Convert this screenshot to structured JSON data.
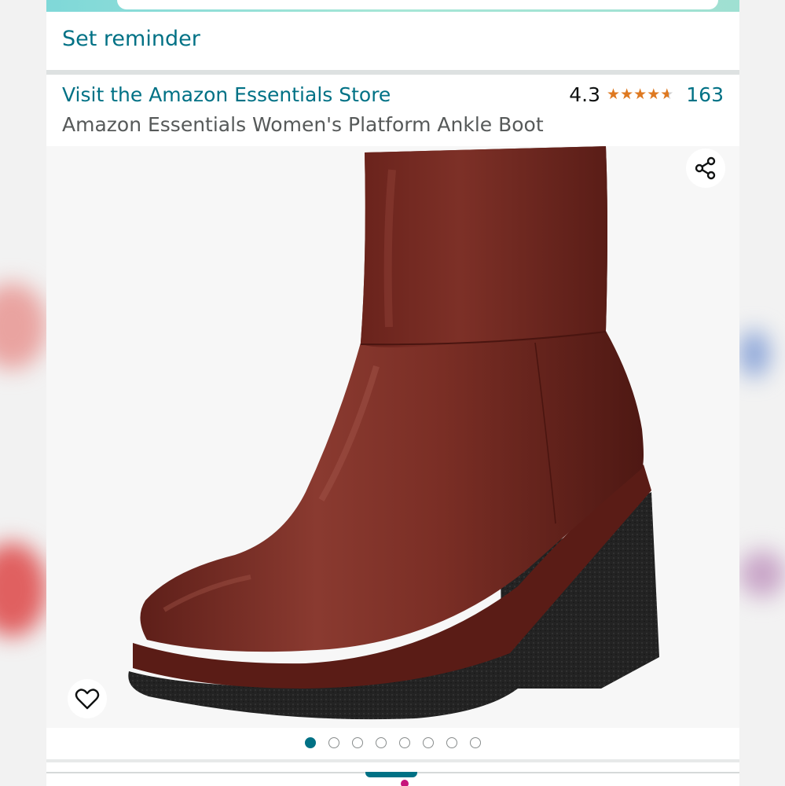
{
  "promo": {
    "reminder_label": "Set reminder"
  },
  "product": {
    "store_link": "Visit the Amazon Essentials Store",
    "title": "Amazon Essentials Women's Platform Ankle Boot",
    "rating": {
      "value": "4.3",
      "stars": 4.3,
      "count": "163"
    }
  },
  "image": {
    "total_images": 8,
    "active_index": 0,
    "share_icon": "share-icon",
    "wishlist_icon": "heart-icon"
  },
  "colors": {
    "link": "#007185",
    "star": "#de7921",
    "text_secondary": "#565959",
    "boot_leather": "#7a2e25",
    "sole": "#222222"
  }
}
